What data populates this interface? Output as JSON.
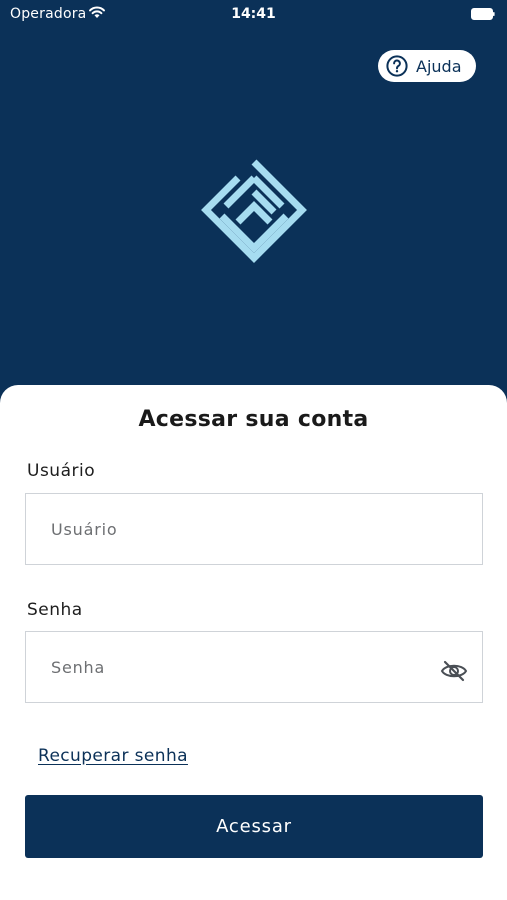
{
  "status_bar": {
    "carrier": "Operadora",
    "time": "14:41",
    "wifi_icon": "wifi-icon",
    "battery_icon": "battery-icon"
  },
  "header": {
    "help_label": "Ajuda",
    "help_icon": "question-circle-icon",
    "logo_icon": "diamond-maze-logo"
  },
  "login": {
    "title": "Acessar sua conta",
    "username_label": "Usuário",
    "username_placeholder": "Usuário",
    "username_value": "",
    "password_label": "Senha",
    "password_placeholder": "Senha",
    "password_value": "",
    "password_toggle_icon": "eye-slash-icon",
    "recover_label": "Recuperar senha",
    "submit_label": "Acessar"
  },
  "colors": {
    "background": "#0b3158",
    "logo": "#a6dcf0",
    "sheet": "#ffffff",
    "button": "#0b3158",
    "border": "#cfd3d8"
  }
}
